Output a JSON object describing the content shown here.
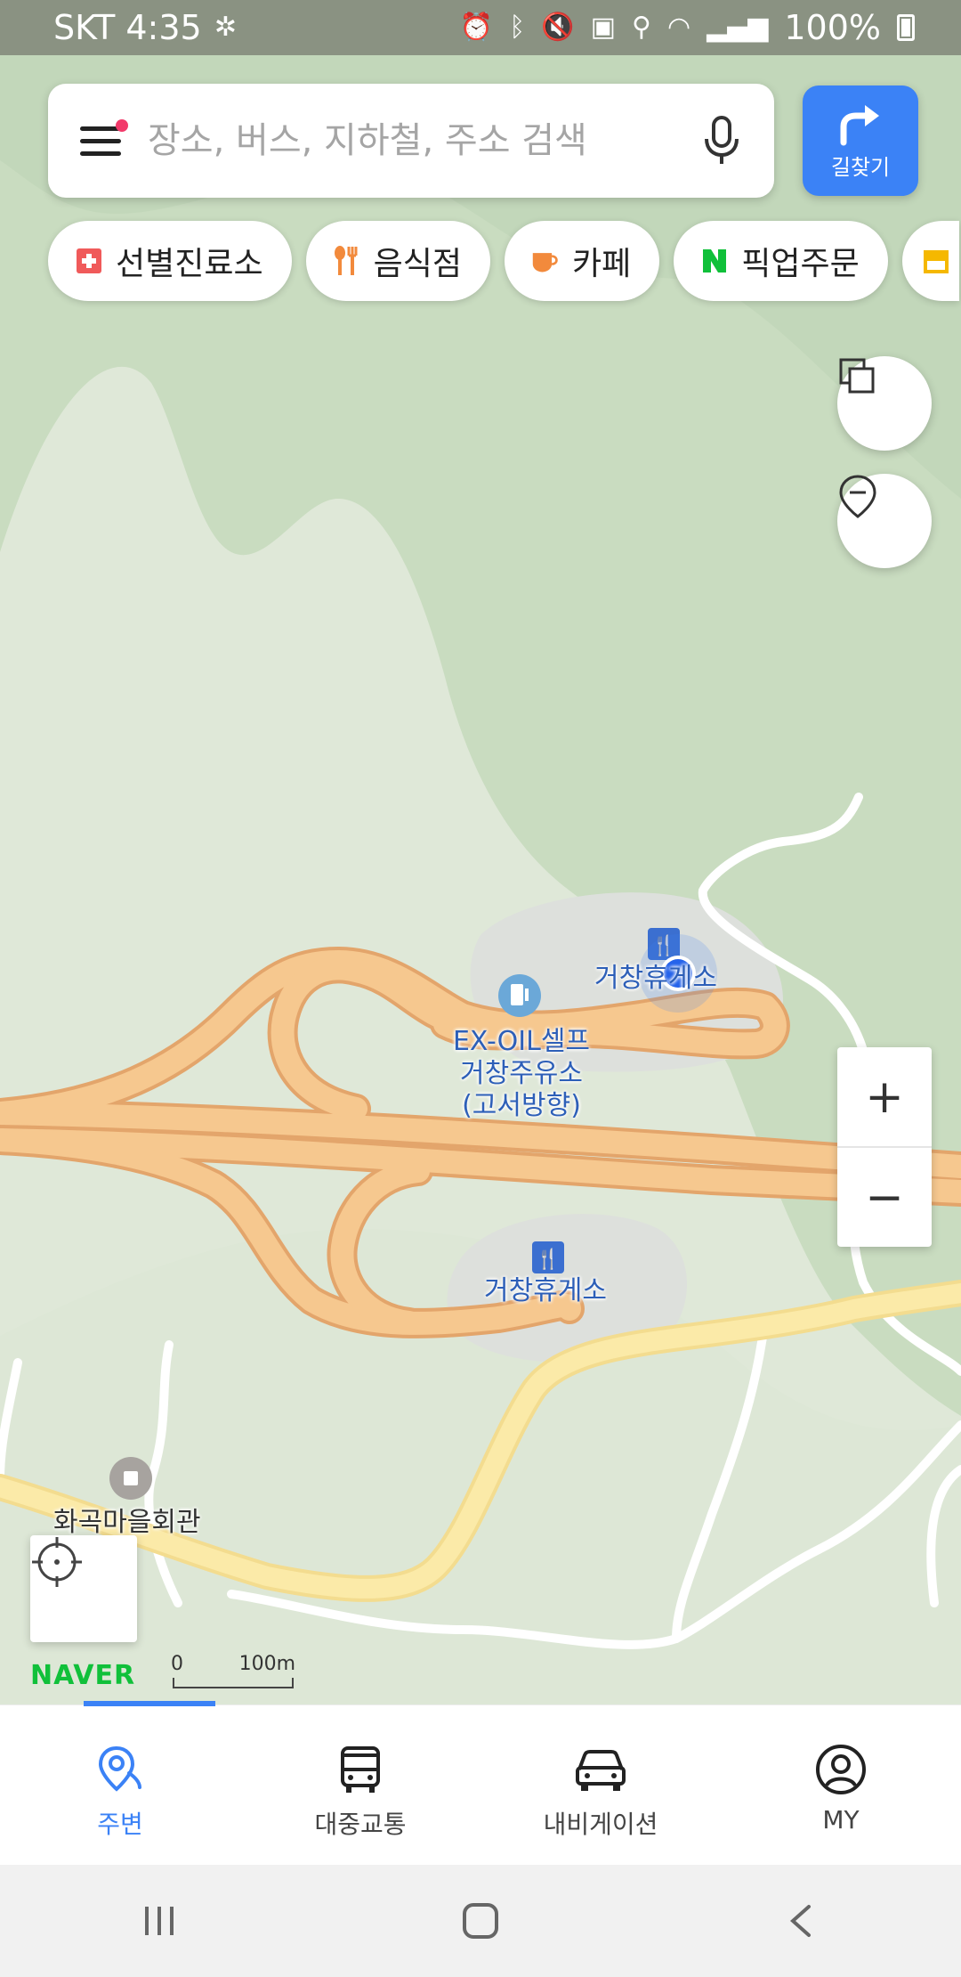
{
  "status_bar": {
    "carrier_time": "SKT 4:35",
    "battery": "100%",
    "icons": [
      "fan-icon",
      "alarm-icon",
      "bluetooth-icon",
      "mute-icon",
      "battery-saver-icon",
      "location-icon",
      "wifi-icon",
      "signal-icon",
      "battery-icon"
    ]
  },
  "search": {
    "placeholder": "장소, 버스, 지하철, 주소 검색",
    "value": ""
  },
  "route_button": {
    "label": "길찾기"
  },
  "chips": [
    {
      "label": "선별진료소",
      "icon": "clinic-icon",
      "color": "#f05a5a"
    },
    {
      "label": "음식점",
      "icon": "restaurant-icon",
      "color": "#f28a3c"
    },
    {
      "label": "카페",
      "icon": "cafe-icon",
      "color": "#f28a3c"
    },
    {
      "label": "픽업주문",
      "icon": "naver-n-icon",
      "color": "#10c03a"
    }
  ],
  "map": {
    "labels": {
      "rest_area_north": "거창휴게소",
      "gas_station": "EX-OIL셀프\n거창주유소\n(고서방향)",
      "rest_area_south": "거창휴게소",
      "village_hall": "화곡마을회관"
    },
    "zoom_in": "+",
    "zoom_out": "−",
    "logo": "NAVER",
    "scale": {
      "start": "0",
      "end": "100m"
    },
    "colors": {
      "land": "#dfe8d8",
      "forest": "#c9dcc0",
      "highway": "#f6c88f",
      "road": "#fbe9a6",
      "accent": "#3b82f6"
    }
  },
  "bottom_nav": [
    {
      "label": "주변",
      "icon": "nearby-icon",
      "active": true
    },
    {
      "label": "대중교통",
      "icon": "bus-icon",
      "active": false
    },
    {
      "label": "내비게이션",
      "icon": "car-icon",
      "active": false
    },
    {
      "label": "MY",
      "icon": "profile-icon",
      "active": false
    }
  ]
}
